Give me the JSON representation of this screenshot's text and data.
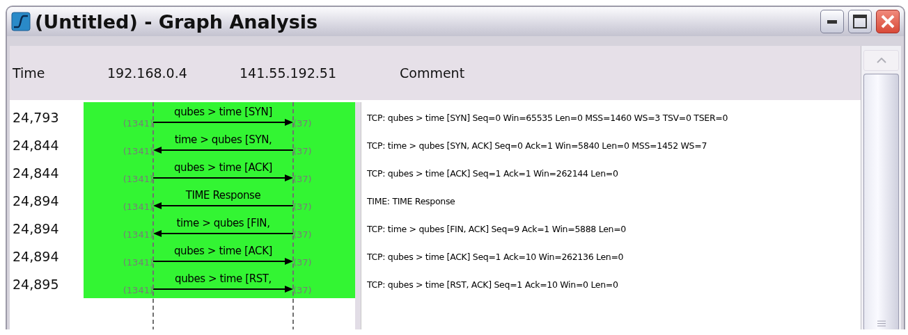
{
  "window": {
    "title": "(Untitled) - Graph Analysis"
  },
  "columns": {
    "time": "Time",
    "host_a": "192.168.0.4",
    "host_b": "141.55.192.51",
    "comment": "Comment"
  },
  "rows": [
    {
      "time": "24,793",
      "label": "qubes > time [SYN]",
      "kind": "rightward",
      "port_a": "(1341)",
      "port_b": "(37)",
      "comment": "TCP: qubes > time [SYN] Seq=0 Win=65535 Len=0 MSS=1460 WS=3 TSV=0 TSER=0"
    },
    {
      "time": "24,844",
      "label": "time > qubes [SYN,",
      "kind": "leftward",
      "port_a": "(1341)",
      "port_b": "(37)",
      "comment": "TCP: time > qubes [SYN, ACK] Seq=0 Ack=1 Win=5840 Len=0 MSS=1452 WS=7"
    },
    {
      "time": "24,844",
      "label": "qubes > time [ACK]",
      "kind": "rightward",
      "port_a": "(1341)",
      "port_b": "(37)",
      "comment": "TCP: qubes > time [ACK] Seq=1 Ack=1 Win=262144 Len=0"
    },
    {
      "time": "24,894",
      "label": "TIME Response",
      "kind": "leftward",
      "port_a": "(1341)",
      "port_b": "(37)",
      "comment": "TIME: TIME Response"
    },
    {
      "time": "24,894",
      "label": "time > qubes [FIN,",
      "kind": "leftward",
      "port_a": "(1341)",
      "port_b": "(37)",
      "comment": "TCP: time > qubes [FIN, ACK] Seq=9 Ack=1 Win=5888 Len=0"
    },
    {
      "time": "24,894",
      "label": "qubes > time [ACK]",
      "kind": "rightward",
      "port_a": "(1341)",
      "port_b": "(37)",
      "comment": "TCP: qubes > time [ACK] Seq=1 Ack=10 Win=262136 Len=0"
    },
    {
      "time": "24,895",
      "label": "qubes > time [RST,",
      "kind": "rightward",
      "port_a": "(1341)",
      "port_b": "(37)",
      "comment": "TCP: qubes > time [RST, ACK] Seq=1 Ack=10 Win=0 Len=0"
    }
  ]
}
